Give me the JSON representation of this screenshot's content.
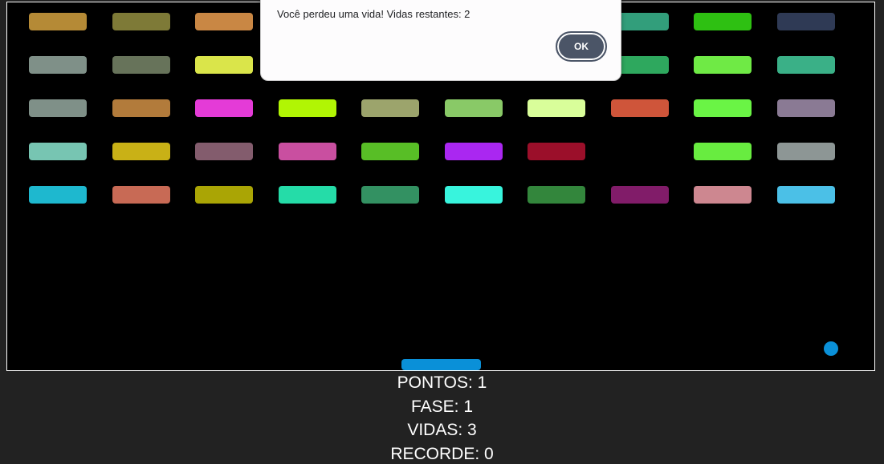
{
  "game": {
    "background": "#000000",
    "border_color": "#ffffff",
    "paddle_color": "#0a90d8",
    "ball_color": "#0a90d8",
    "bricks": [
      [
        "#b58a36",
        "#7e7a37",
        "#c98744",
        null,
        null,
        null,
        null,
        "#329e7b",
        "#2ec012",
        "#2f3a55"
      ],
      [
        "#7f9088",
        "#67735a",
        "#dae54a",
        null,
        null,
        null,
        null,
        "#2ea85e",
        "#6fea45",
        "#3ab087"
      ],
      [
        "#7f9088",
        "#b27b3b",
        "#e43bd7",
        "#b1f504",
        "#9ca46c",
        "#89c967",
        "#d9fe9a",
        "#cf553a",
        "#6af445",
        "#8a7a94"
      ],
      [
        "#77c5b2",
        "#c9b116",
        "#835c6d",
        "#c94fa0",
        "#58be26",
        "#aa27f1",
        "#9b0f2a",
        null,
        "#68ec40",
        "#8d9695"
      ],
      [
        "#1eb8cf",
        "#c86a55",
        "#aaa505",
        "#25dca8",
        "#339162",
        "#38f4dd",
        "#33863c",
        "#811c69",
        "#cd8790",
        "#4bc0e7"
      ]
    ]
  },
  "stats": {
    "points": "PONTOS: 1",
    "level": "FASE: 1",
    "lives": "VIDAS: 3",
    "record": "RECORDE: 0"
  },
  "alert": {
    "message": "Você perdeu uma vida! Vidas restantes: 2",
    "ok_label": "OK"
  }
}
